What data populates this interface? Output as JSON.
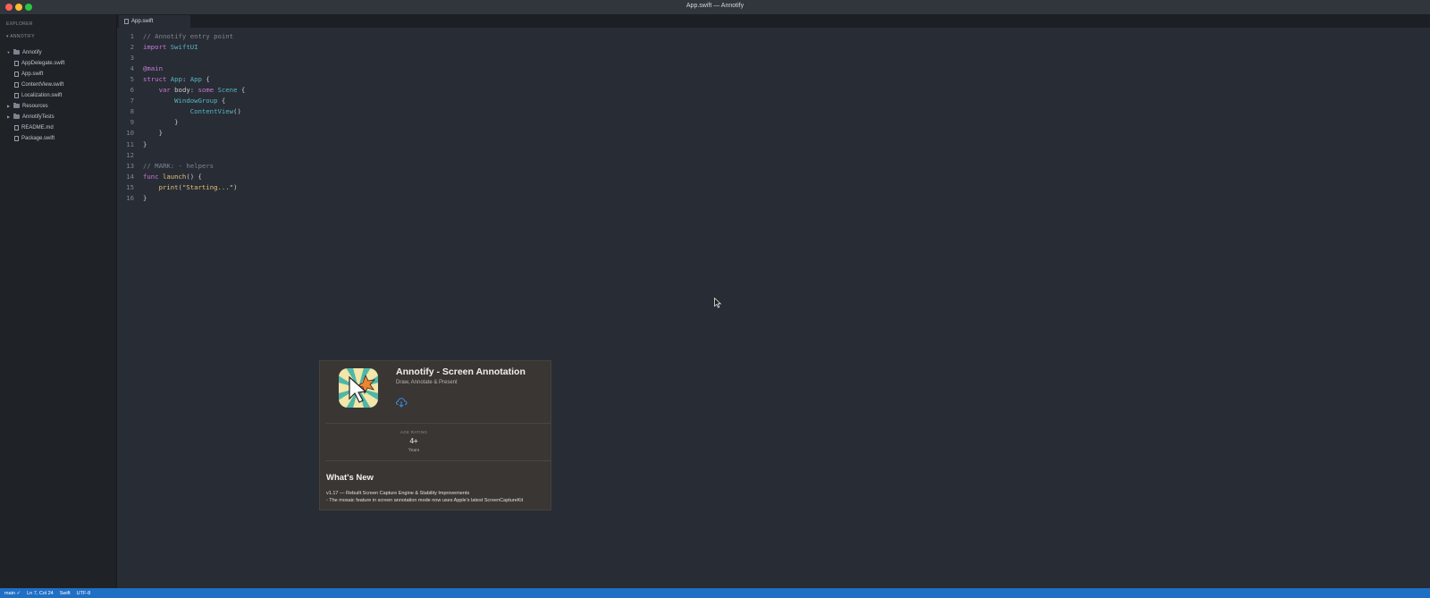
{
  "window": {
    "title": "App.swift — Annotify"
  },
  "sidebar": {
    "header": "EXPLORER",
    "section": "ANNOTIFY",
    "items": [
      {
        "label": "Annotify",
        "type": "folder",
        "expanded": true
      },
      {
        "label": "AppDelegate.swift",
        "type": "file"
      },
      {
        "label": "App.swift",
        "type": "file"
      },
      {
        "label": "ContentView.swift",
        "type": "file"
      },
      {
        "label": "Localization.swift",
        "type": "file"
      },
      {
        "label": "Resources",
        "type": "folder",
        "expanded": false
      },
      {
        "label": "AnnotifyTests",
        "type": "folder",
        "expanded": false
      },
      {
        "label": "README.md",
        "type": "file"
      },
      {
        "label": "Package.swift",
        "type": "file"
      }
    ]
  },
  "tabs": [
    {
      "label": "App.swift",
      "active": true
    }
  ],
  "editor": {
    "lines": [
      {
        "n": "1",
        "tokens": [
          {
            "t": "// Annotify entry point",
            "c": "cm"
          }
        ]
      },
      {
        "n": "2",
        "tokens": [
          {
            "t": "import ",
            "c": "kw"
          },
          {
            "t": "SwiftUI",
            "c": "ty"
          }
        ]
      },
      {
        "n": "3",
        "tokens": []
      },
      {
        "n": "4",
        "tokens": [
          {
            "t": "@main",
            "c": "at"
          }
        ]
      },
      {
        "n": "5",
        "tokens": [
          {
            "t": "struct ",
            "c": "kw"
          },
          {
            "t": "App",
            "c": "ty"
          },
          {
            "t": ": ",
            "c": "pl"
          },
          {
            "t": "App",
            "c": "ty"
          },
          {
            "t": " {",
            "c": "pl"
          }
        ]
      },
      {
        "n": "6",
        "tokens": [
          {
            "t": "    var ",
            "c": "kw"
          },
          {
            "t": "body",
            "c": "pl"
          },
          {
            "t": ": ",
            "c": "pl"
          },
          {
            "t": "some ",
            "c": "kw"
          },
          {
            "t": "Scene",
            "c": "ty"
          },
          {
            "t": " {",
            "c": "pl"
          }
        ]
      },
      {
        "n": "7",
        "tokens": [
          {
            "t": "        WindowGroup",
            "c": "ty"
          },
          {
            "t": " {",
            "c": "pl"
          }
        ]
      },
      {
        "n": "8",
        "tokens": [
          {
            "t": "            ContentView",
            "c": "ty"
          },
          {
            "t": "()",
            "c": "pl"
          }
        ]
      },
      {
        "n": "9",
        "tokens": [
          {
            "t": "        }",
            "c": "pl"
          }
        ]
      },
      {
        "n": "10",
        "tokens": [
          {
            "t": "    }",
            "c": "pl"
          }
        ]
      },
      {
        "n": "11",
        "tokens": [
          {
            "t": "}",
            "c": "pl"
          }
        ]
      },
      {
        "n": "12",
        "tokens": []
      },
      {
        "n": "13",
        "tokens": [
          {
            "t": "// MARK: - helpers",
            "c": "cm"
          }
        ]
      },
      {
        "n": "14",
        "tokens": [
          {
            "t": "func ",
            "c": "kw"
          },
          {
            "t": "launch",
            "c": "fn"
          },
          {
            "t": "() {",
            "c": "pl"
          }
        ]
      },
      {
        "n": "15",
        "tokens": [
          {
            "t": "    print",
            "c": "fn"
          },
          {
            "t": "(",
            "c": "pl"
          },
          {
            "t": "\"Starting...\"",
            "c": "st"
          },
          {
            "t": ")",
            "c": "pl"
          }
        ]
      },
      {
        "n": "16",
        "tokens": [
          {
            "t": "}",
            "c": "pl"
          }
        ]
      }
    ]
  },
  "app_card": {
    "title": "Annotify - Screen Annotation",
    "subtitle": "Draw, Annotate & Present",
    "download_icon": "cloud-download-icon",
    "age_label": "AGE RATING",
    "age_value": "4+",
    "age_unit": "Years",
    "whats_new_title": "What's New",
    "whats_new_line1": "v1.17 — Rebuilt Screen Capture Engine & Stability Improvements",
    "whats_new_line2": "- The mosaic feature in screen annotation mode now uses Apple's latest ScreenCaptureKit"
  },
  "statusbar": {
    "branch": "main ✓",
    "position": "Ln 7, Col 24",
    "language": "Swift",
    "encoding": "UTF-8"
  },
  "colors": {
    "editor_bg": "#282c34",
    "sidebar_bg": "#1f2227",
    "statusbar_bg": "#1f6fc5",
    "card_bg": "#3a3633"
  }
}
